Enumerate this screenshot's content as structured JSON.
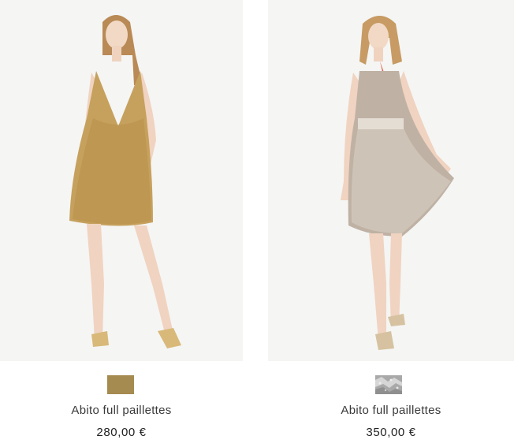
{
  "products": [
    {
      "name": "Abito full paillettes",
      "price": "280,00 €",
      "image_icon": "gold-sequin-dress-photo",
      "swatch_color": "#a68b50"
    },
    {
      "name": "Abito full paillettes",
      "price": "350,00 €",
      "image_icon": "silver-beaded-dress-photo",
      "swatch_color": "#a9a9a9"
    }
  ]
}
